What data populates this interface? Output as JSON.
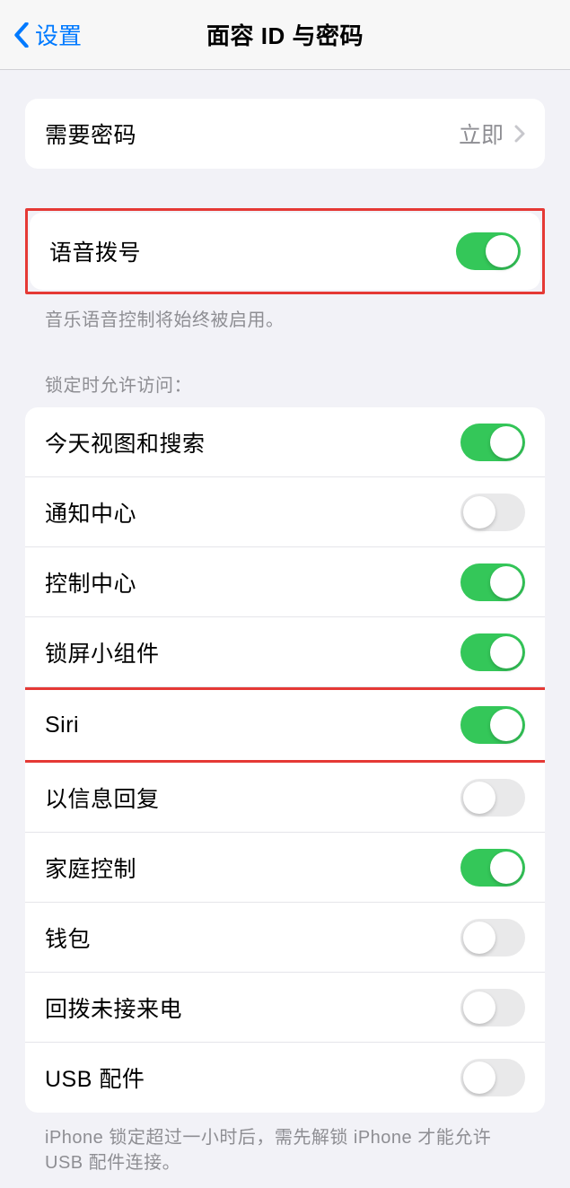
{
  "header": {
    "back_label": "设置",
    "title": "面容 ID 与密码"
  },
  "require_passcode": {
    "label": "需要密码",
    "value": "立即"
  },
  "voice_dial": {
    "label": "语音拨号",
    "on": true,
    "footer": "音乐语音控制将始终被启用。"
  },
  "lock_access": {
    "header": "锁定时允许访问：",
    "items": [
      {
        "label": "今天视图和搜索",
        "on": true
      },
      {
        "label": "通知中心",
        "on": false
      },
      {
        "label": "控制中心",
        "on": true
      },
      {
        "label": "锁屏小组件",
        "on": true
      },
      {
        "label": "Siri",
        "on": true
      },
      {
        "label": "以信息回复",
        "on": false
      },
      {
        "label": "家庭控制",
        "on": true
      },
      {
        "label": "钱包",
        "on": false
      },
      {
        "label": "回拨未接来电",
        "on": false
      },
      {
        "label": "USB 配件",
        "on": false
      }
    ],
    "footer": "iPhone 锁定超过一小时后，需先解锁 iPhone 才能允许 USB 配件连接。"
  }
}
